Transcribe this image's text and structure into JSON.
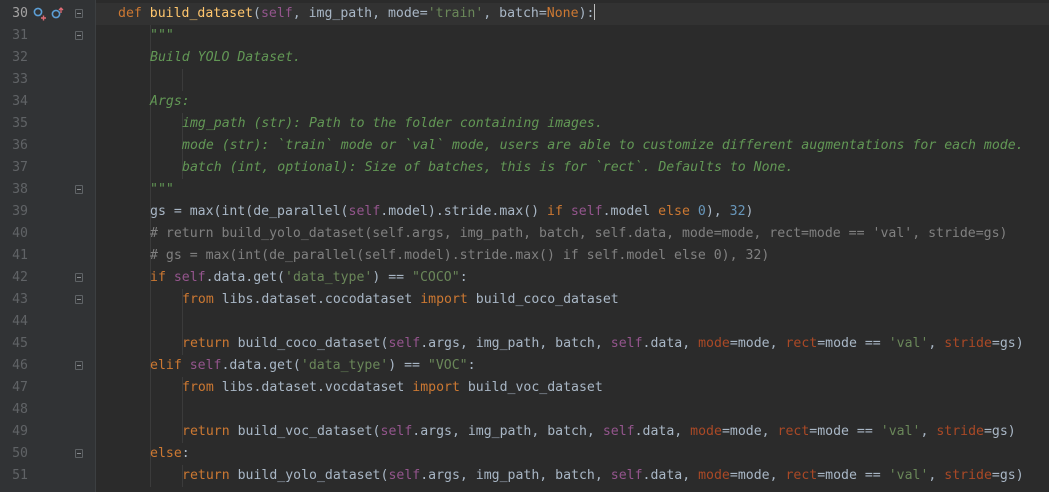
{
  "editor": {
    "current_line": 30,
    "lines": [
      {
        "n": "30",
        "indent": 1,
        "tokens": [
          [
            "kw",
            "def "
          ],
          [
            "fn",
            "build_dataset"
          ],
          [
            "df",
            "("
          ],
          [
            "sf",
            "self"
          ],
          [
            "df",
            ", img_path, mode="
          ],
          [
            "st",
            "'train'"
          ],
          [
            "df",
            ", batch="
          ],
          [
            "kw",
            "None"
          ],
          [
            "df",
            "):"
          ]
        ]
      },
      {
        "n": "31",
        "indent": 2,
        "tokens": [
          [
            "dc",
            "\"\"\""
          ]
        ]
      },
      {
        "n": "32",
        "indent": 2,
        "tokens": [
          [
            "dc",
            "Build YOLO Dataset."
          ]
        ]
      },
      {
        "n": "33",
        "indent": 0,
        "tokens": []
      },
      {
        "n": "34",
        "indent": 2,
        "tokens": [
          [
            "dc",
            "Args:"
          ]
        ]
      },
      {
        "n": "35",
        "indent": 3,
        "tokens": [
          [
            "dc",
            "img_path (str): Path to the folder containing images."
          ]
        ]
      },
      {
        "n": "36",
        "indent": 3,
        "tokens": [
          [
            "dc",
            "mode (str): `train` mode or `val` mode, users are able to customize different augmentations for each mode."
          ]
        ]
      },
      {
        "n": "37",
        "indent": 3,
        "tokens": [
          [
            "dc",
            "batch (int, optional): Size of batches, this is for `rect`. Defaults to None."
          ]
        ]
      },
      {
        "n": "38",
        "indent": 2,
        "tokens": [
          [
            "dc",
            "\"\"\""
          ]
        ]
      },
      {
        "n": "39",
        "indent": 2,
        "tokens": [
          [
            "df",
            "gs = max(int(de_parallel("
          ],
          [
            "sf",
            "self"
          ],
          [
            "df",
            ".model).stride.max() "
          ],
          [
            "kw",
            "if "
          ],
          [
            "sf",
            "self"
          ],
          [
            "df",
            ".model "
          ],
          [
            "kw",
            "else "
          ],
          [
            "nu",
            "0"
          ],
          [
            "df",
            "), "
          ],
          [
            "nu",
            "32"
          ],
          [
            "df",
            ")"
          ]
        ]
      },
      {
        "n": "40",
        "indent": 2,
        "tokens": [
          [
            "cm",
            "# return build_yolo_dataset(self.args, img_path, batch, self.data, mode=mode, rect=mode == 'val', stride=gs)"
          ]
        ]
      },
      {
        "n": "41",
        "indent": 2,
        "tokens": [
          [
            "cm",
            "# gs = max(int(de_parallel(self.model).stride.max() if self.model else 0), 32)"
          ]
        ]
      },
      {
        "n": "42",
        "indent": 2,
        "tokens": [
          [
            "kw",
            "if "
          ],
          [
            "sf",
            "self"
          ],
          [
            "df",
            ".data.get("
          ],
          [
            "st",
            "'data_type'"
          ],
          [
            "df",
            ") == "
          ],
          [
            "st",
            "\"COCO\""
          ],
          [
            "df",
            ":"
          ]
        ]
      },
      {
        "n": "43",
        "indent": 3,
        "tokens": [
          [
            "kw",
            "from "
          ],
          [
            "df",
            "libs.dataset.cocodataset "
          ],
          [
            "kw",
            "import "
          ],
          [
            "df",
            "build_coco_dataset"
          ]
        ]
      },
      {
        "n": "44",
        "indent": 0,
        "tokens": []
      },
      {
        "n": "45",
        "indent": 3,
        "tokens": [
          [
            "kw",
            "return "
          ],
          [
            "df",
            "build_coco_dataset("
          ],
          [
            "sf",
            "self"
          ],
          [
            "df",
            ".args, img_path, batch, "
          ],
          [
            "sf",
            "self"
          ],
          [
            "df",
            ".data, "
          ],
          [
            "pa",
            "mode"
          ],
          [
            "df",
            "=mode, "
          ],
          [
            "pa",
            "rect"
          ],
          [
            "df",
            "=mode == "
          ],
          [
            "st",
            "'val'"
          ],
          [
            "df",
            ", "
          ],
          [
            "pa",
            "stride"
          ],
          [
            "df",
            "=gs)"
          ]
        ]
      },
      {
        "n": "46",
        "indent": 2,
        "tokens": [
          [
            "kw",
            "elif "
          ],
          [
            "sf",
            "self"
          ],
          [
            "df",
            ".data.get("
          ],
          [
            "st",
            "'data_type'"
          ],
          [
            "df",
            ") == "
          ],
          [
            "st",
            "\"VOC\""
          ],
          [
            "df",
            ":"
          ]
        ]
      },
      {
        "n": "47",
        "indent": 3,
        "tokens": [
          [
            "kw",
            "from "
          ],
          [
            "df",
            "libs.dataset.vocdataset "
          ],
          [
            "kw",
            "import "
          ],
          [
            "df",
            "build_voc_dataset"
          ]
        ]
      },
      {
        "n": "48",
        "indent": 0,
        "tokens": []
      },
      {
        "n": "49",
        "indent": 3,
        "tokens": [
          [
            "kw",
            "return "
          ],
          [
            "df",
            "build_voc_dataset("
          ],
          [
            "sf",
            "self"
          ],
          [
            "df",
            ".args, img_path, batch, "
          ],
          [
            "sf",
            "self"
          ],
          [
            "df",
            ".data, "
          ],
          [
            "pa",
            "mode"
          ],
          [
            "df",
            "=mode, "
          ],
          [
            "pa",
            "rect"
          ],
          [
            "df",
            "=mode == "
          ],
          [
            "st",
            "'val'"
          ],
          [
            "df",
            ", "
          ],
          [
            "pa",
            "stride"
          ],
          [
            "df",
            "=gs)"
          ]
        ]
      },
      {
        "n": "50",
        "indent": 2,
        "tokens": [
          [
            "kw",
            "else"
          ],
          [
            "df",
            ":"
          ]
        ]
      },
      {
        "n": "51",
        "indent": 3,
        "tokens": [
          [
            "kw",
            "return "
          ],
          [
            "df",
            "build_yolo_dataset("
          ],
          [
            "sf",
            "self"
          ],
          [
            "df",
            ".args, img_path, batch, "
          ],
          [
            "sf",
            "self"
          ],
          [
            "df",
            ".data, "
          ],
          [
            "pa",
            "mode"
          ],
          [
            "df",
            "=mode, "
          ],
          [
            "pa",
            "rect"
          ],
          [
            "df",
            "=mode == "
          ],
          [
            "st",
            "'val'"
          ],
          [
            "df",
            ", "
          ],
          [
            "pa",
            "stride"
          ],
          [
            "df",
            "=gs)"
          ]
        ]
      }
    ],
    "fold_marker_lines": [
      "30",
      "31",
      "38",
      "42",
      "43",
      "46",
      "50"
    ],
    "gutter_icons": [
      "override-icon",
      "overridden-icon"
    ],
    "colors": {
      "background": "#2b2b2b",
      "keyword": "#cc7832",
      "function": "#ffc66d",
      "self": "#94558d",
      "param": "#aa4926",
      "string": "#6a8759",
      "number": "#6897bb",
      "comment": "#808080",
      "docstring": "#629755"
    }
  }
}
